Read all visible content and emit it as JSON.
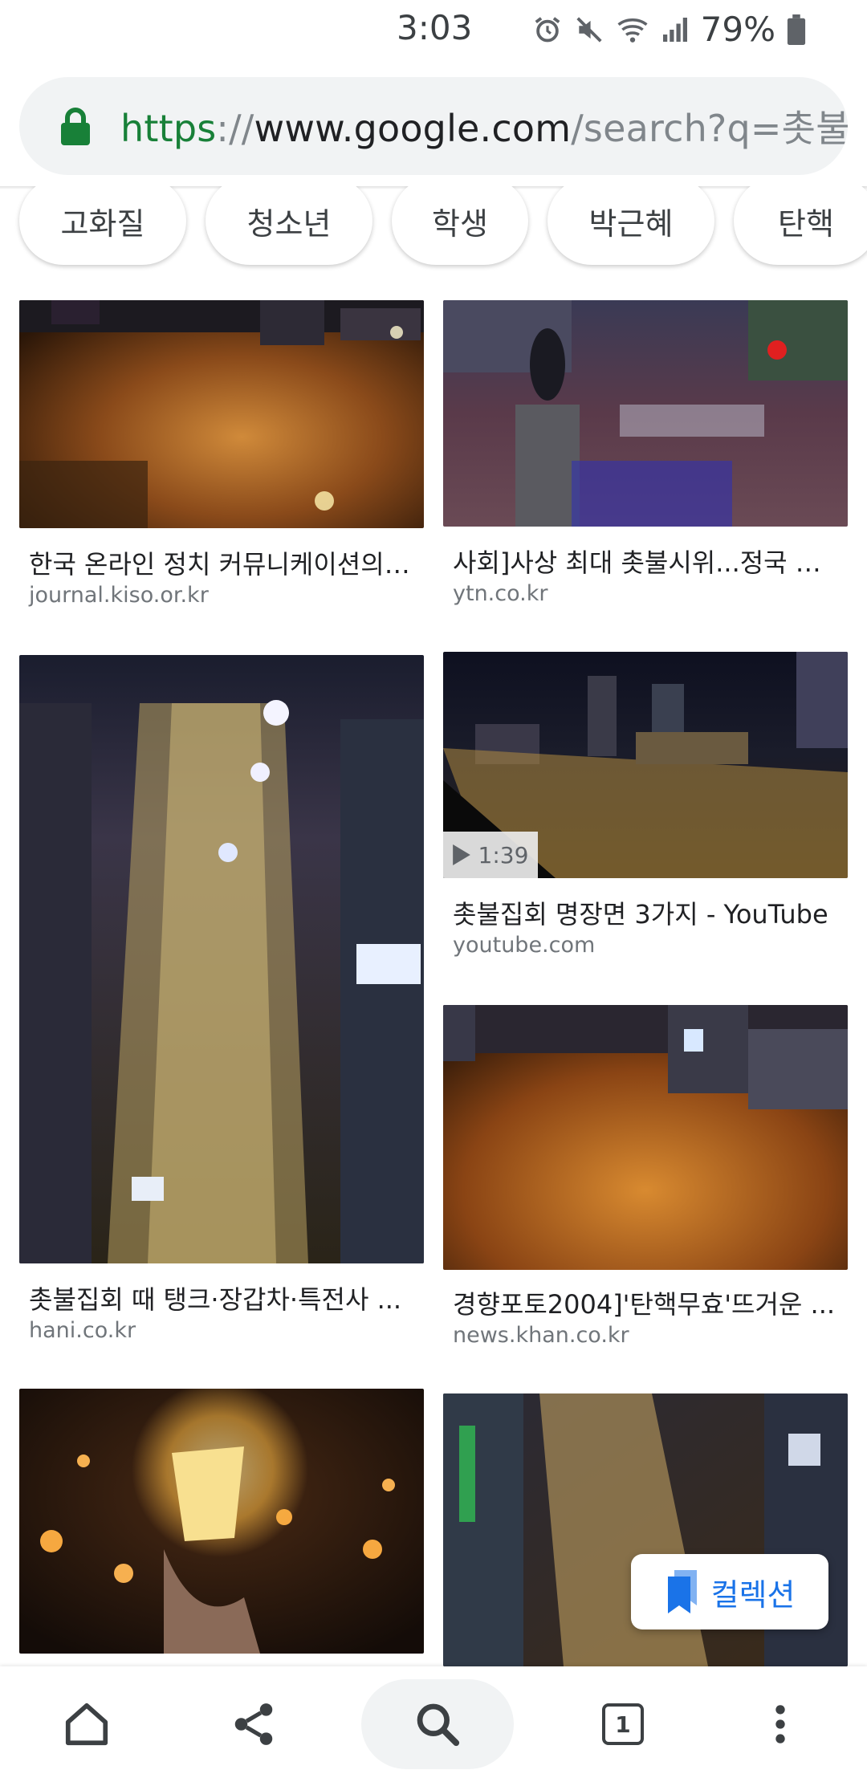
{
  "status": {
    "time": "3:03",
    "battery": "79%"
  },
  "url": {
    "scheme": "https",
    "separator": "://",
    "host": "www.google.com",
    "path": "/search?q=촛불시"
  },
  "chips": [
    "고화질",
    "청소년",
    "학생",
    "박근혜",
    "탄핵"
  ],
  "results": [
    {
      "title": "한국 온라인 정치 커뮤니케이션의 ...",
      "source": "journal.kiso.or.kr"
    },
    {
      "title": "사회]사상 최대 촛불시위...정국 최...",
      "source": "ytn.co.kr"
    },
    {
      "title": "촛불집회 때 탱크·장갑차·특전사 ...",
      "source": "hani.co.kr"
    },
    {
      "title": "촛불집회 명장면 3가지 - YouTube",
      "source": "youtube.com",
      "duration": "1:39"
    },
    {
      "title": "경향포토2004]'탄핵무효'뜨거운 ...",
      "source": "news.khan.co.kr"
    }
  ],
  "collection_label": "컬렉션",
  "tabs_count": "1",
  "icons": {
    "lock": "lock-icon",
    "alarm": "alarm-icon",
    "mute": "mute-icon",
    "wifi": "wifi-icon",
    "signal": "signal-icon",
    "battery": "battery-icon",
    "home": "home-icon",
    "share": "share-icon",
    "search": "search-icon",
    "tabs": "tabs-icon",
    "menu": "more-vert-icon",
    "bookmark": "bookmark-icon",
    "play": "play-icon"
  },
  "colors": {
    "accent": "#1a73e8",
    "secure": "#188038"
  }
}
